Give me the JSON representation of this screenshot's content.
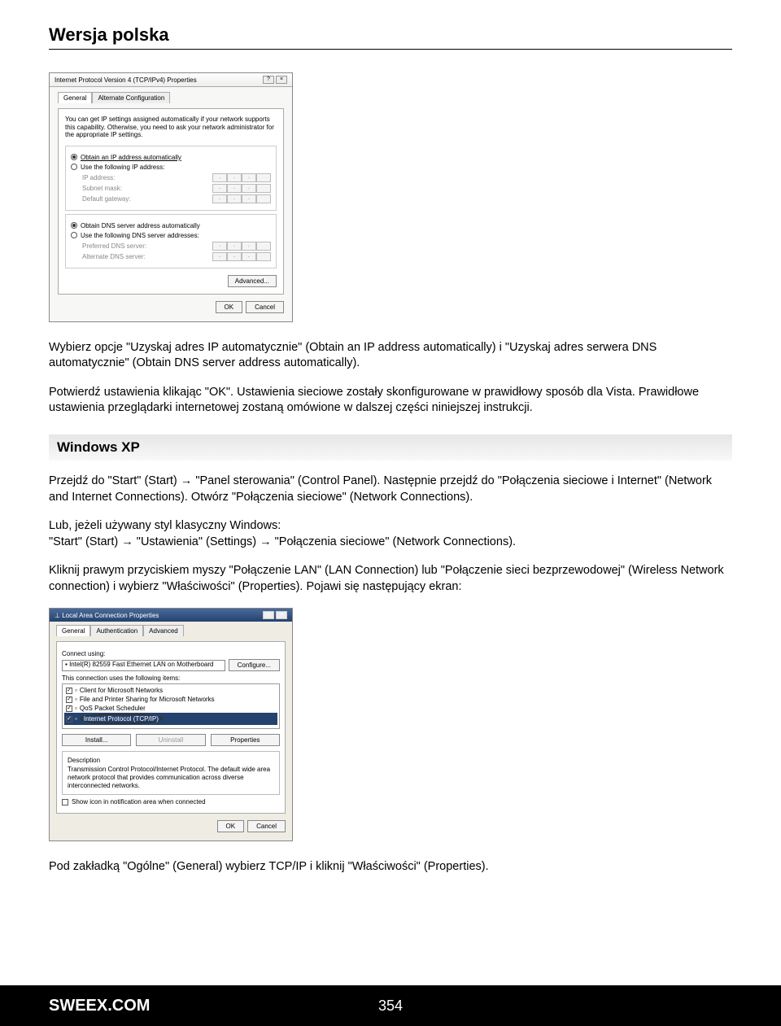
{
  "header": {
    "title": "Wersja polska"
  },
  "dialog1": {
    "title": "Internet Protocol Version 4 (TCP/IPv4) Properties",
    "tab_general": "General",
    "tab_alt": "Alternate Configuration",
    "desc": "You can get IP settings assigned automatically if your network supports this capability. Otherwise, you need to ask your network administrator for the appropriate IP settings.",
    "r_obtain_ip": "Obtain an IP address automatically",
    "r_use_ip": "Use the following IP address:",
    "f_ip": "IP address:",
    "f_subnet": "Subnet mask:",
    "f_gateway": "Default gateway:",
    "r_obtain_dns": "Obtain DNS server address automatically",
    "r_use_dns": "Use the following DNS server addresses:",
    "f_pref_dns": "Preferred DNS server:",
    "f_alt_dns": "Alternate DNS server:",
    "btn_adv": "Advanced...",
    "btn_ok": "OK",
    "btn_cancel": "Cancel"
  },
  "para1": "Wybierz opcje \"Uzyskaj adres IP automatycznie\" (Obtain an IP address automatically) i \"Uzyskaj adres serwera DNS automatycznie\" (Obtain DNS server address automatically).",
  "para2": "Potwierdź ustawienia klikając \"OK\". Ustawienia sieciowe zostały skonfigurowane w prawidłowy sposób dla Vista. Prawidłowe ustawienia przeglądarki internetowej zostaną omówione w dalszej części niniejszej instrukcji.",
  "section_xp": "Windows XP",
  "para3a": "Przejdź do \"Start\" (Start) ",
  "para3b": " \"Panel sterowania\" (Control Panel). Następnie przejdź do \"Połączenia sieciowe i Internet\" (Network and Internet Connections). Otwórz \"Połączenia sieciowe\" (Network Connections).",
  "para4a": "Lub, jeżeli używany styl klasyczny Windows:",
  "para4b": "\"Start\" (Start) ",
  "para4c": " \"Ustawienia\" (Settings) ",
  "para4d": " \"Połączenia sieciowe\" (Network Connections).",
  "para5": "Kliknij prawym przyciskiem myszy \"Połączenie LAN\" (LAN Connection) lub \"Połączenie sieci bezprzewodowej\" (Wireless Network connection) i wybierz \"Właściwości\" (Properties). Pojawi się następujący ekran:",
  "dialog2": {
    "title": "Local Area Connection Properties",
    "tab_general": "General",
    "tab_auth": "Authentication",
    "tab_adv": "Advanced",
    "lbl_connect": "Connect using:",
    "adapter": "Intel(R) 82559 Fast Ethernet LAN on Motherboard",
    "btn_configure": "Configure...",
    "lbl_items": "This connection uses the following items:",
    "item1": "Client for Microsoft Networks",
    "item2": "File and Printer Sharing for Microsoft Networks",
    "item3": "QoS Packet Scheduler",
    "item4": "Internet Protocol (TCP/IP)",
    "btn_install": "Install...",
    "btn_uninstall": "Uninstall",
    "btn_props": "Properties",
    "lbl_desc": "Description",
    "desc": "Transmission Control Protocol/Internet Protocol. The default wide area network protocol that provides communication across diverse interconnected networks.",
    "chk_show": "Show icon in notification area when connected",
    "btn_ok": "OK",
    "btn_cancel": "Cancel"
  },
  "para6": "Pod zakładką \"Ogólne\" (General) wybierz TCP/IP i kliknij \"Właściwości\" (Properties).",
  "footer": {
    "brand": "SWEEX.COM",
    "page": "354"
  },
  "arrow": "→"
}
